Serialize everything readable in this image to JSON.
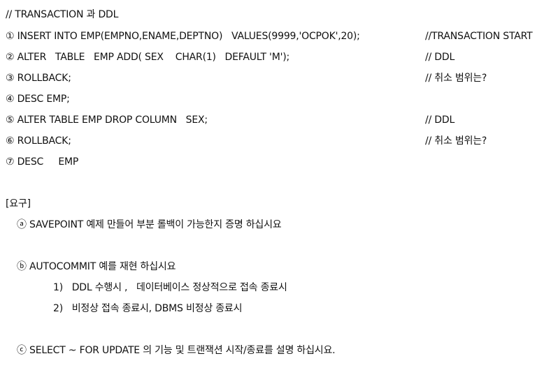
{
  "doc": {
    "title": "// TRANSACTION 과 DDL",
    "code_lines": [
      {
        "text": "① INSERT INTO EMP(EMPNO,ENAME,DEPTNO)   VALUES(9999,'OCPOK',20);",
        "comment": "//TRANSACTION START"
      },
      {
        "text": "② ALTER   TABLE   EMP ADD( SEX    CHAR(1)   DEFAULT 'M');",
        "comment": "// DDL"
      },
      {
        "text": "③ ROLLBACK;",
        "comment": "// 취소 범위는?"
      },
      {
        "text": "④ DESC EMP;",
        "comment": ""
      },
      {
        "text": "⑤ ALTER TABLE EMP DROP COLUMN   SEX;",
        "comment": "// DDL"
      },
      {
        "text": "⑥ ROLLBACK;",
        "comment": "// 취소 범위는?"
      },
      {
        "text": "⑦ DESC     EMP",
        "comment": ""
      }
    ],
    "requirements_heading": "[요구]",
    "req_a": "ⓐ SAVEPOINT 예제 만들어 부분 롤백이 가능한지 증명 하십시요",
    "req_b": "ⓑ AUTOCOMMIT 예를 재현 하십시요",
    "req_b_1": "1)   DDL 수행시 ,   데이터베이스 정상적으로 접속 종료시",
    "req_b_2": "2)   비정상 접속 종료시, DBMS 비정상 종료시",
    "req_c": "ⓒ SELECT ~ FOR UPDATE 의 기능 및 트랜잭션 시작/종료를 설명 하십시요."
  }
}
